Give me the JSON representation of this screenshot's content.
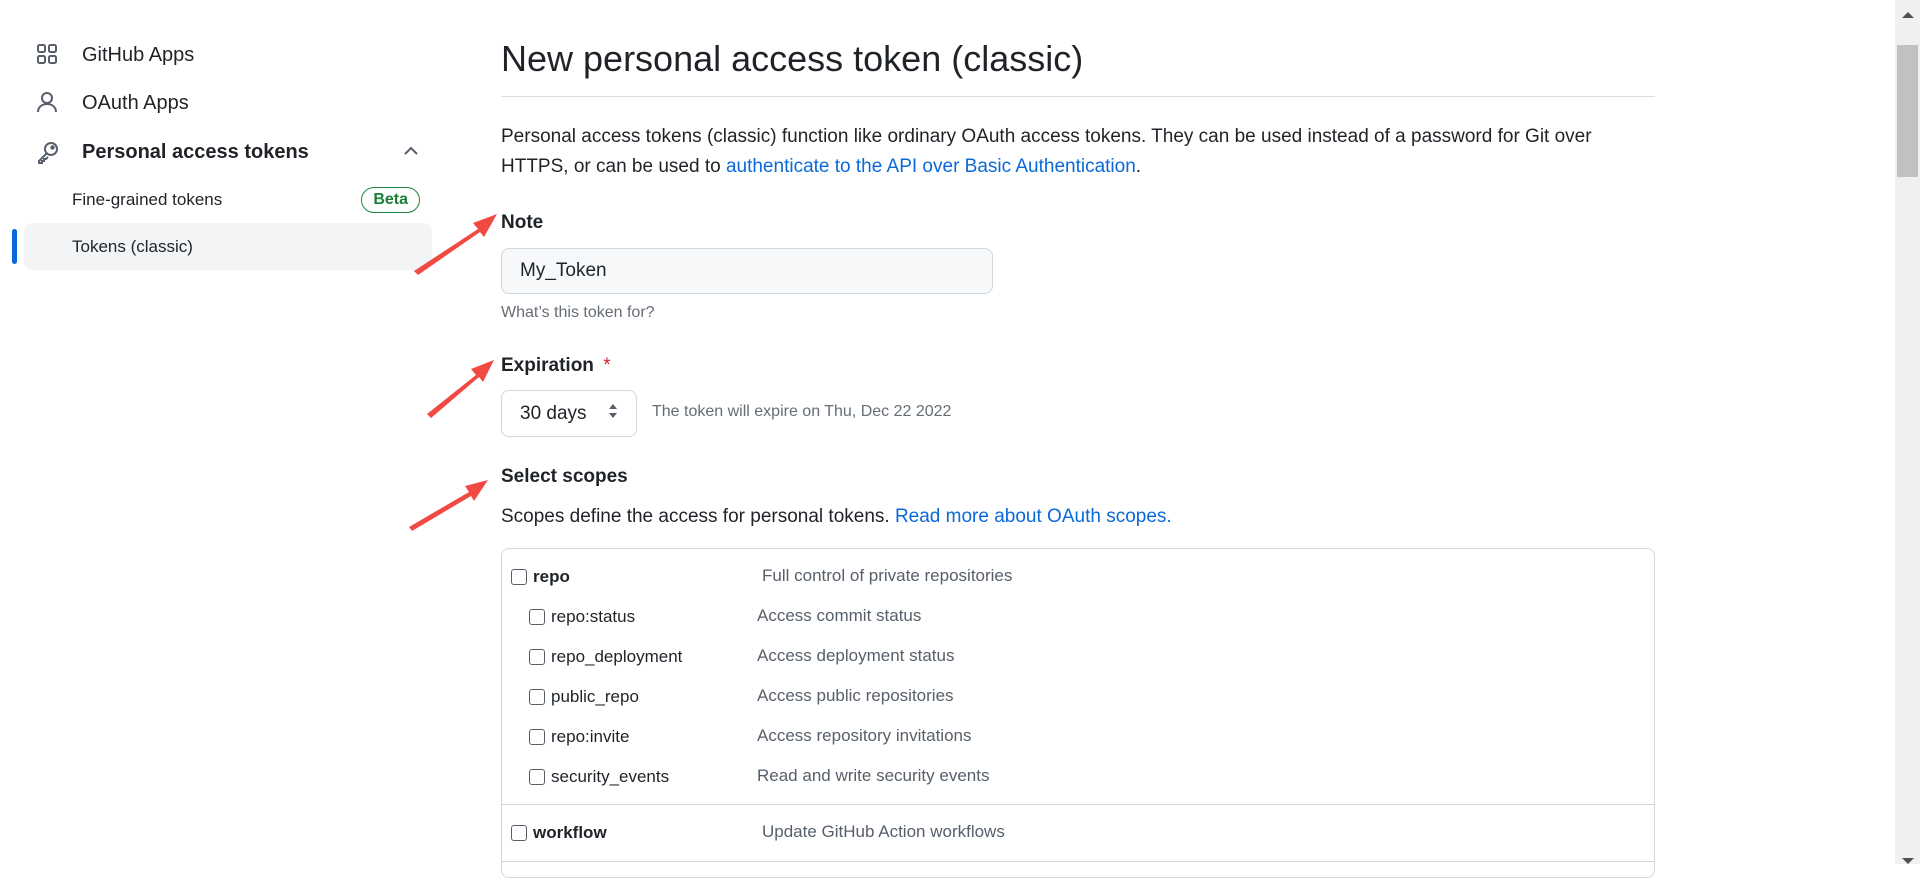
{
  "sidebar": {
    "items": [
      {
        "label": "GitHub Apps",
        "icon": "apps-grid-icon"
      },
      {
        "label": "OAuth Apps",
        "icon": "person-icon"
      },
      {
        "label": "Personal access tokens",
        "icon": "key-icon",
        "expanded": true
      }
    ],
    "subitems": [
      {
        "label": "Fine-grained tokens",
        "badge": "Beta"
      },
      {
        "label": "Tokens (classic)",
        "active": true
      }
    ]
  },
  "main": {
    "title": "New personal access token (classic)",
    "description": "Personal access tokens (classic) function like ordinary OAuth access tokens. They can be used instead of a password for Git over HTTPS, or can be used to ",
    "description_link": "authenticate to the API over Basic Authentication",
    "description_end": ".",
    "note": {
      "label": "Note",
      "value": "My_Token",
      "hint": "What’s this token for?"
    },
    "expiration": {
      "label": "Expiration",
      "required_mark": "*",
      "selected": "30 days",
      "info": "The token will expire on Thu, Dec 22 2022"
    },
    "scopes": {
      "label": "Select scopes",
      "description": "Scopes define the access for personal tokens. ",
      "link": "Read more about OAuth scopes.",
      "groups": [
        {
          "name": "repo",
          "desc": "Full control of private repositories",
          "checked": false,
          "children": [
            {
              "name": "repo:status",
              "desc": "Access commit status",
              "checked": false
            },
            {
              "name": "repo_deployment",
              "desc": "Access deployment status",
              "checked": false
            },
            {
              "name": "public_repo",
              "desc": "Access public repositories",
              "checked": false
            },
            {
              "name": "repo:invite",
              "desc": "Access repository invitations",
              "checked": false
            },
            {
              "name": "security_events",
              "desc": "Read and write security events",
              "checked": false
            }
          ]
        },
        {
          "name": "workflow",
          "desc": "Update GitHub Action workflows",
          "checked": false
        }
      ]
    }
  },
  "colors": {
    "link": "#0969da",
    "active_indicator": "#0969da",
    "beta": "#1a7f37",
    "annotation_arrow": "#f04a43",
    "required": "#cf222e"
  }
}
